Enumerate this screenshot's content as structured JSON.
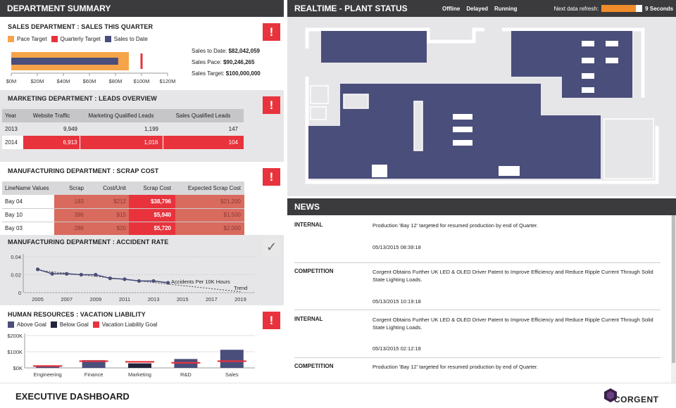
{
  "left_header": "DEPARTMENT SUMMARY",
  "plant_header": {
    "title": "REALTIME - PLANT STATUS",
    "statuses": [
      "Offline",
      "Delayed",
      "Running"
    ],
    "refresh_label": "Next data refresh:",
    "refresh_value": "9 Seconds",
    "refresh_progress": 0.85
  },
  "sales": {
    "title": "SALES DEPARTMENT : SALES THIS QUARTER",
    "legend": [
      "Pace Target",
      "Quarterly Target",
      "Sales to Date"
    ],
    "colors": {
      "pace": "#f5a44a",
      "quarterly": "#e8333d",
      "sales": "#4a4e7a"
    },
    "ticks": [
      "$0M",
      "$20M",
      "$40M",
      "$60M",
      "$80M",
      "$100M",
      "$120M"
    ],
    "summary": [
      {
        "label": "Sales to Date:",
        "value": "$82,042,059"
      },
      {
        "label": "Sales Pace:",
        "value": "$90,246,265"
      },
      {
        "label": "Sales Target:",
        "value": "$100,000,000"
      }
    ]
  },
  "marketing": {
    "title": "MARKETING DEPARTMENT : LEADS OVERVIEW",
    "headers": [
      "Year",
      "Website Traffic",
      "Marketing Qualified Leads",
      "Sales Qualified Leads"
    ],
    "rows": [
      [
        "2013",
        "9,949",
        "1,199",
        "147"
      ],
      [
        "2014",
        "6,913",
        "1,016",
        "104"
      ]
    ]
  },
  "scrap": {
    "title": "MANUFACTURING DEPARTMENT : SCRAP COST",
    "headers": [
      "LineName Values",
      "Scrap",
      "Cost/Unit",
      "Scrap Cost",
      "Expected Scrap Cost"
    ],
    "rows": [
      [
        "Bay 04",
        "183",
        "$212",
        "$38,796",
        "$21,200"
      ],
      [
        "Bay 10",
        "396",
        "$15",
        "$5,940",
        "$1,500"
      ],
      [
        "Bay 03",
        "286",
        "$20",
        "$5,720",
        "$2,000"
      ]
    ]
  },
  "accident": {
    "title": "MANUFACTURING DEPARTMENT : ACCIDENT RATE",
    "y_ticks": [
      "0.04",
      "0.02",
      "0"
    ],
    "x_ticks": [
      "2005",
      "2007",
      "2009",
      "2011",
      "2013",
      "2015",
      "2017",
      "2019"
    ],
    "series_label": "Accidents Per 10K Hours",
    "trend_label": "Trend"
  },
  "hr": {
    "title": "HUMAN RESOURCES : VACATION LIABILITY",
    "legend": [
      "Above Goal",
      "Below Goal",
      "Vacation Liability Goal"
    ],
    "colors": {
      "above": "#4a4e7a",
      "below": "#22243a",
      "goal": "#e8333d"
    },
    "y_ticks": [
      "$200K",
      "$100K",
      "$0K"
    ],
    "categories": [
      "Engineering",
      "Finance",
      "Marketing",
      "R&D",
      "Sales"
    ]
  },
  "news": {
    "title": "NEWS",
    "items": [
      {
        "category": "INTERNAL",
        "text": "Production 'Bay 12' targeted for resumed production by end of Quarter.",
        "date": "05/13/2015 08:39:18"
      },
      {
        "category": "COMPETITION",
        "text": "Corgent Obtains Further UK LED & OLED Driver Patent to Improve Efficiency and Reduce Ripple Current Through Solid State Lighting Loads.",
        "date": "05/13/2015 10:19:18"
      },
      {
        "category": "INTERNAL",
        "text": "Corgent Obtains Further UK LED & OLED Driver Patent to Improve Efficiency and Reduce Ripple Current Through Solid State Lighting Loads.",
        "date": "05/13/2015 02:12:18"
      },
      {
        "category": "COMPETITION",
        "text": "Production 'Bay 12' targeted for resumed production by end of Quarter.",
        "date": ""
      }
    ]
  },
  "footer": {
    "title": "EXECUTIVE DASHBOARD",
    "brand": "CORGENT"
  },
  "chart_data": [
    {
      "type": "bar",
      "title": "SALES DEPARTMENT : SALES THIS QUARTER",
      "orientation": "horizontal",
      "series": [
        {
          "name": "Pace Target",
          "values": [
            90.246
          ]
        },
        {
          "name": "Sales to Date",
          "values": [
            82.042
          ]
        },
        {
          "name": "Quarterly Target",
          "values": [
            100
          ]
        }
      ],
      "xlim": [
        0,
        120
      ]
    },
    {
      "type": "line",
      "title": "MANUFACTURING DEPARTMENT : ACCIDENT RATE",
      "x": [
        2005,
        2006,
        2007,
        2008,
        2009,
        2010,
        2011,
        2012,
        2013,
        2014
      ],
      "series": [
        {
          "name": "Accidents Per 10K Hours",
          "values": [
            0.026,
            0.021,
            0.021,
            0.02,
            0.02,
            0.016,
            0.015,
            0.013,
            0.013,
            0.011
          ]
        }
      ],
      "trend": {
        "name": "Trend",
        "x": [
          2005,
          2019
        ],
        "values": [
          0.025,
          0.001
        ]
      },
      "xlim": [
        2004,
        2020
      ],
      "ylim": [
        0,
        0.04
      ]
    },
    {
      "type": "bar",
      "title": "HUMAN RESOURCES : VACATION LIABILITY",
      "categories": [
        "Engineering",
        "Finance",
        "Marketing",
        "R&D",
        "Sales"
      ],
      "series": [
        {
          "name": "Above Goal",
          "values": [
            15,
            48,
            0,
            55,
            112
          ]
        },
        {
          "name": "Below Goal",
          "values": [
            0,
            0,
            28,
            0,
            0
          ]
        },
        {
          "name": "Vacation Liability Goal",
          "values": [
            12,
            42,
            38,
            32,
            42
          ]
        }
      ],
      "ylim": [
        0,
        200
      ]
    }
  ]
}
